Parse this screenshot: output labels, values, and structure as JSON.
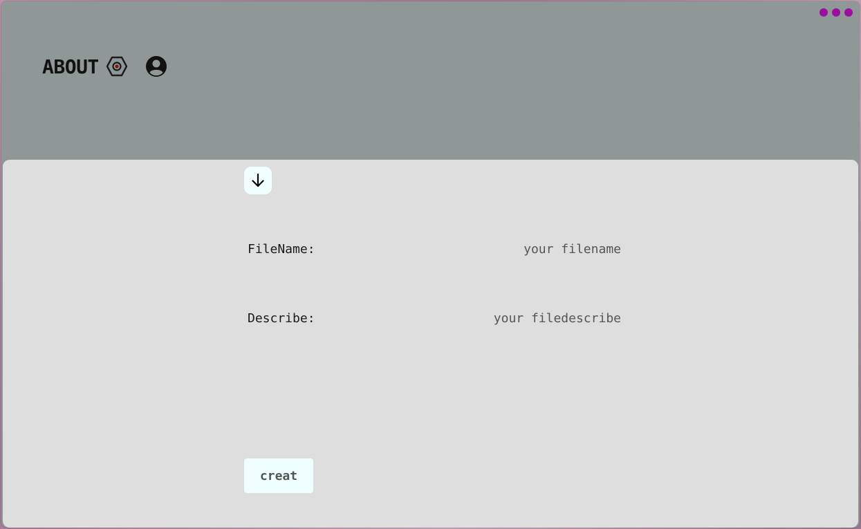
{
  "header": {
    "title": "ABOUT",
    "settings_icon": "settings-hex-icon",
    "user_icon": "account-circle-icon"
  },
  "window_controls": {
    "icon": "more-dots-icon",
    "color": "#9b0f9f"
  },
  "panel": {
    "collapse_icon": "arrow-down-icon",
    "fields": [
      {
        "label": "FileName:",
        "placeholder": "your filename",
        "value": ""
      },
      {
        "label": "Describe:",
        "placeholder": "your filedescribe",
        "value": ""
      }
    ],
    "submit_label": "creat"
  },
  "colors": {
    "header_bg": "#8f9797",
    "panel_bg": "#dedede",
    "button_bg": "#f0ffff",
    "accent": "#9b0f9f",
    "settings_dot": "#8b1010"
  }
}
